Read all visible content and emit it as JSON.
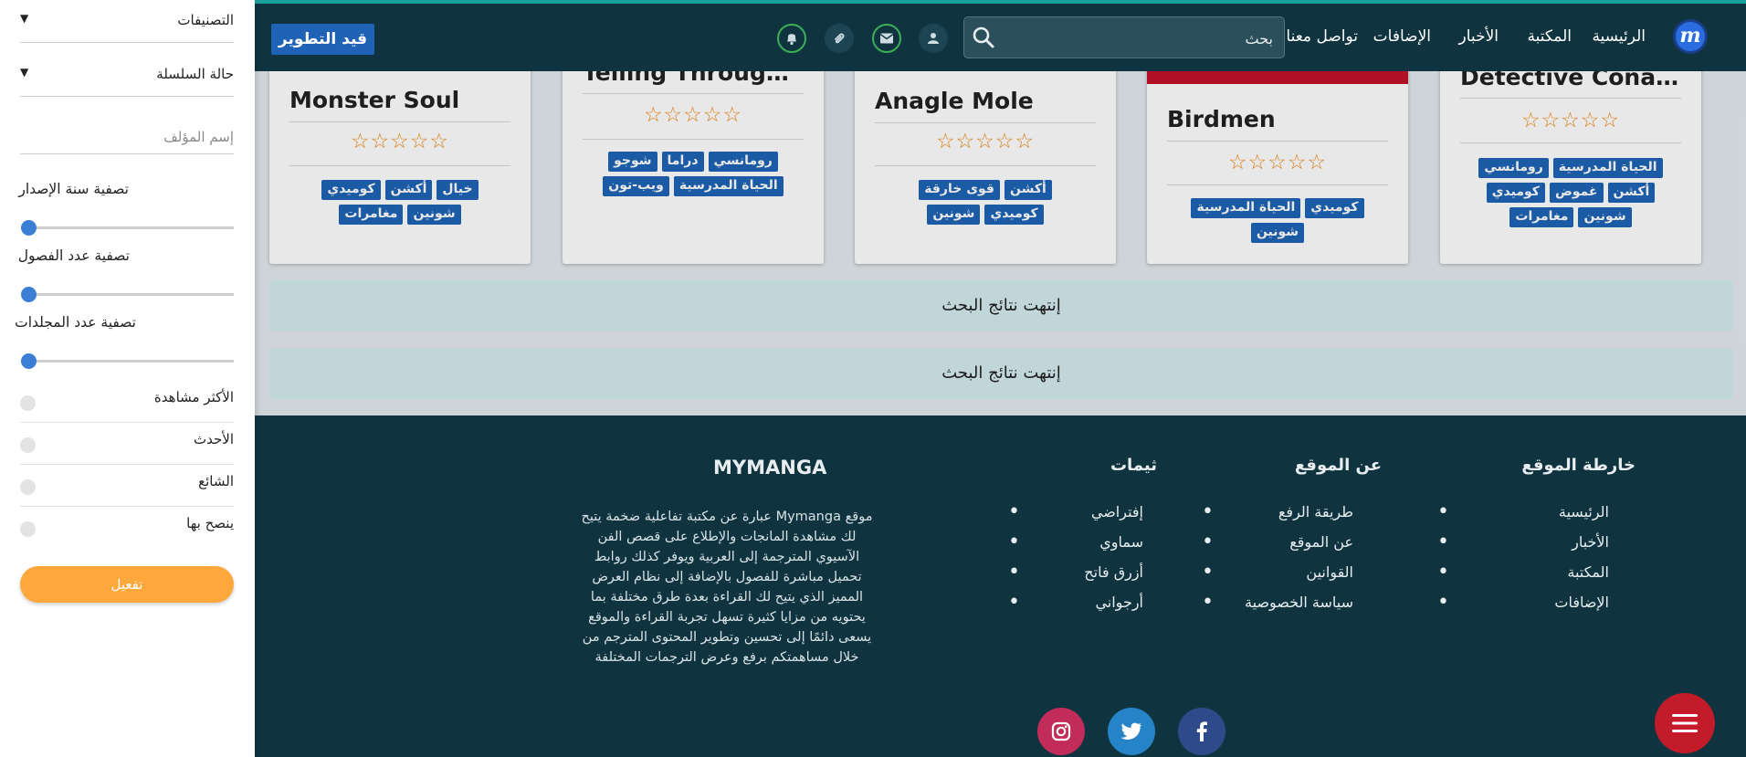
{
  "header": {
    "logo_letter": "m",
    "nav": [
      "الرئيسية",
      "المكتبة",
      "الأخبار",
      "الإضافات",
      "تواصل معنا"
    ],
    "search_placeholder": "بحث",
    "dev_button": "قيد التطوير"
  },
  "cards": [
    {
      "title": "Monster Soul",
      "stars": "☆☆☆☆☆",
      "tags": [
        "خيال",
        "أكشن",
        "كوميدي",
        "شونين",
        "مغامرات"
      ]
    },
    {
      "title": "Telling Through ...",
      "stars": "☆☆☆☆☆",
      "tags": [
        "رومانسي",
        "دراما",
        "شوجو",
        "الحياة المدرسية",
        "ويب-تون"
      ]
    },
    {
      "title": "Anagle Mole",
      "stars": "☆☆☆☆☆",
      "tags": [
        "أكشن",
        "قوى خارقة",
        "كوميدي",
        "شونين"
      ]
    },
    {
      "title": "Birdmen",
      "stars": "☆☆☆☆☆",
      "tags": [
        "كوميدي",
        "الحياة المدرسية",
        "شونين"
      ]
    },
    {
      "title": "Detective Conan ...",
      "stars": "☆☆☆☆☆",
      "tags": [
        "الحياة المدرسية",
        "رومانسي",
        "أكشن",
        "غموض",
        "كوميدي",
        "شونين",
        "مغامرات"
      ]
    }
  ],
  "end_results": [
    "إنتهت نتائج البحث",
    "إنتهت نتائج البحث"
  ],
  "footer": {
    "sitemap": {
      "title": "خارطة الموقع",
      "items": [
        "الرئيسية",
        "الأخبار",
        "المكتبة",
        "الإضافات"
      ]
    },
    "about": {
      "title": "عن الموقع",
      "items": [
        "طريقة الرفع",
        "عن الموقع",
        "القوانين",
        "سياسة الخصوصية"
      ]
    },
    "themes": {
      "title": "ثيمات",
      "items": [
        "إفتراضي",
        "سماوي",
        "أزرق فاتح",
        "أرجواني"
      ]
    },
    "brand": {
      "title": "MYMANGA",
      "description": "موقع Mymanga عبارة عن مكتبة تفاعلية ضخمة يتيح لك مشاهدة المانجات والإطلاع على قصص الفن الآسيوي المترجمة إلى العربية ويوفر كذلك روابط تحميل مباشرة للفصول بالإضافة إلى نظام العرض المميز الذي يتيح لك القراءة بعدة طرق مختلفة بما يحتويه من مزايا كثيرة تسهل تجربة القراءة والموقع يسعى دائمًا إلى تحسين وتطوير المحتوى المترجم من خلال مساهمتكم برفع وعرض الترجمات المختلفة"
    },
    "social": [
      "facebook-icon",
      "twitter-icon",
      "instagram-icon"
    ]
  },
  "sidebar": {
    "categories": "التصنيفات",
    "series_status": "حالة السلسلة",
    "author_placeholder": "إسم المؤلف",
    "year_filter": "تصفية سنة الإصدار",
    "chapters_filter": "تصفية عدد الفصول",
    "volumes_filter": "تصفية عدد المجلدات",
    "sliders": {
      "year": 0,
      "chapters": 0,
      "volumes": 0
    },
    "sort_options": [
      "الأكثر مشاهدة",
      "الأحدث",
      "الشائع",
      "ينصح بها"
    ],
    "activate_button": "تفعيل"
  },
  "colors": {
    "navy": "#0f3440",
    "tag_blue": "#1e63b6",
    "star_orange": "#f08c1e",
    "activate_orange": "#fea83b",
    "fab_red": "#c41b2b"
  }
}
